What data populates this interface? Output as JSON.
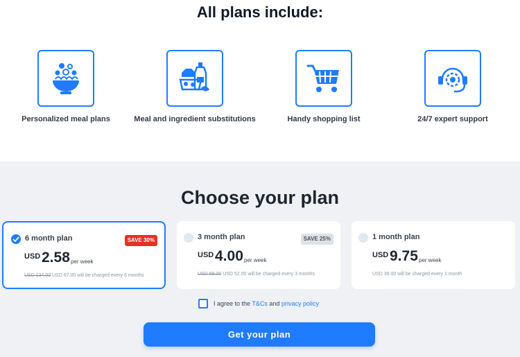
{
  "features": {
    "title": "All plans include:",
    "items": [
      {
        "label": "Personalized meal plans",
        "icon": "salad-bowl-icon"
      },
      {
        "label": "Meal and ingredient substitutions",
        "icon": "groceries-icon"
      },
      {
        "label": "Handy shopping list",
        "icon": "shopping-cart-icon"
      },
      {
        "label": "24/7 expert support",
        "icon": "headset-support-icon"
      }
    ]
  },
  "plans": {
    "title": "Choose your plan",
    "items": [
      {
        "name": "6 month plan",
        "badge": "SAVE 30%",
        "currency": "USD",
        "price": "2.58",
        "per": "per week",
        "old_price": "USD 134.00",
        "charge": "USD 67.00 will be charged every 6 months",
        "selected": true
      },
      {
        "name": "3 month plan",
        "badge": "SAVE 25%",
        "currency": "USD",
        "price": "4.00",
        "per": "per week",
        "old_price": "USD 69.00",
        "charge": "USD 52.00 will be charged every 3 months",
        "selected": false
      },
      {
        "name": "1 month plan",
        "badge": "",
        "currency": "USD",
        "price": "9.75",
        "per": "per week",
        "old_price": "",
        "charge": "USD 39.00 will be charged every 1 month",
        "selected": false
      }
    ]
  },
  "agreement": {
    "prefix": "I agree to the",
    "tcs": "T&Cs",
    "and": "and",
    "privacy": "privacy policy"
  },
  "cta": {
    "label": "Get your plan"
  },
  "colors": {
    "accent": "#1f7bff",
    "save_badge": "#e53023",
    "panel_bg": "#eff1f5"
  }
}
